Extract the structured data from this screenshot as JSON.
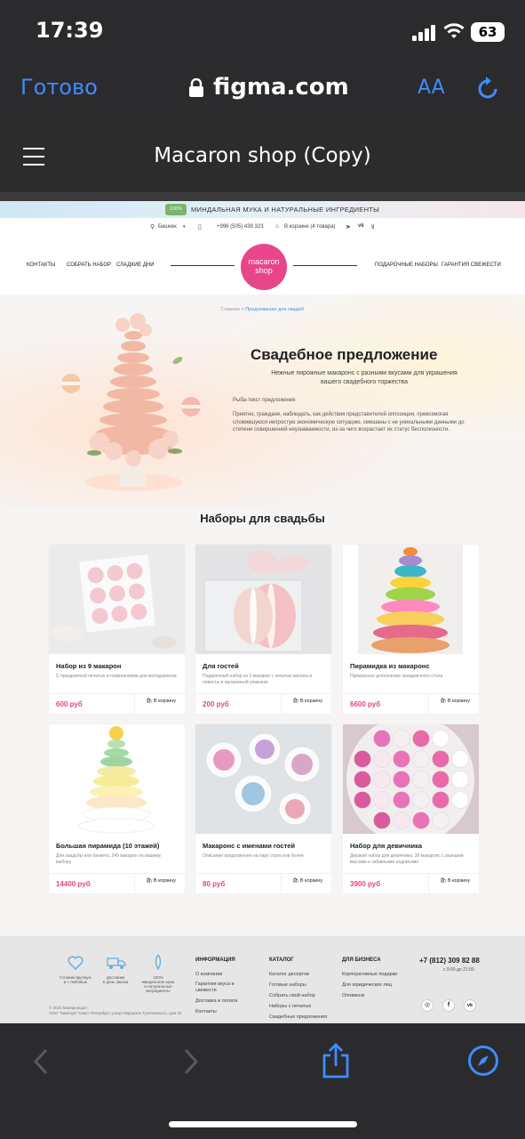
{
  "status": {
    "time": "17:39",
    "battery": "63"
  },
  "safari": {
    "done": "Готово",
    "url": "figma.com",
    "aa": "AA"
  },
  "figma": {
    "title": "Macaron shop (Copy)"
  },
  "site": {
    "promo": "МИНДАЛЬНАЯ МУКА И НАТУРАЛЬНЫЕ ИНГРЕДИЕНТЫ",
    "promo_badge": "100%",
    "city": "Бишкек",
    "phone": "+996 (505) 439 323",
    "cart": "В корзине (4 товара)",
    "nav_left": [
      "КОНТАКТЫ",
      "СОБРАТЬ НАБОР",
      "СЛАДКИЕ ДНИ"
    ],
    "nav_right": [
      "ПОДАРОЧНЫЕ НАБОРЫ",
      "ГАРАНТИЯ СВЕЖЕСТИ"
    ],
    "logo_line1": "macaron",
    "logo_line2": "shop",
    "breadcrumb_home": "Главная",
    "breadcrumb_sep": ">",
    "breadcrumb_current": "Предложение для свадеб",
    "hero_title": "Свадебное предложение",
    "hero_sub": "Нежные пирожные макаронс с разными вкусами для украшения вашего свадебного торжества",
    "fish_label": "Рыба-текст предложения",
    "hero_body": "Приятно, граждане, наблюдать, как действия представителей оппозиции, превозмогая сложившуюся непростую экономическую ситуацию, смешаны с не уникальными данными до степени совершенной неузнаваемости, из-за чего возрастает их статус бесполезности.",
    "sets_title": "Наборы для свадьбы",
    "cart_button": "В корзину",
    "products": [
      {
        "name": "Набор из 9 макарон",
        "desc": "С праздничной печатью и пожеланиями для молодоженов",
        "price": "600 руб"
      },
      {
        "name": "Для гостей",
        "desc": "Подарочный набор из 2 макарон с печатью жениха и невесты в прозрачной упаковке",
        "price": "200 руб"
      },
      {
        "name": "Пирамидка из макаронс",
        "desc": "Прекрасное дополнение праздничного стола",
        "price": "6600 руб"
      },
      {
        "name": "Большая пирамида (10 этажей)",
        "desc": "Для свадьбы или банкета, 240 макарон по вашему выбору",
        "price": "14400 руб"
      },
      {
        "name": "Макаронс с именами гостей",
        "desc": "Описание предложения на пару строк или более",
        "price": "80 руб"
      },
      {
        "name": "Набор для девичника",
        "desc": "Дерзкий набор для девичника. 30 макаронс с разными вкусами и забавными надписями",
        "price": "3900 руб"
      }
    ],
    "footer": {
      "badges": [
        {
          "label": "Готовим вручную\nи с любовью"
        },
        {
          "label": "Доставим\nв день заказа"
        },
        {
          "label": "100%\nминдальная мука\nи натуральные\nингредиенты"
        }
      ],
      "copyright": "© 2021 Макаронщоп\nООО \"Каинзуи\" Санкт-Петербург, улица Маршала Тухачевского, дом 22",
      "col1_title": "ИНФОРМАЦИЯ",
      "col1": [
        "О компании",
        "Гарантии вкуса и свежести",
        "Доставка и оплата",
        "Контакты"
      ],
      "col2_title": "КАТАЛОГ",
      "col2": [
        "Каталог десертов",
        "Готовые наборы",
        "Собрать свой набор",
        "Наборы с печатью",
        "Свадебные предложения"
      ],
      "col3_title": "ДЛЯ БИЗНЕСА",
      "col3": [
        "Корпоративные подарки",
        "Для юридических лиц",
        "Оповиксм"
      ],
      "phone": "+7 (812) 309 82 88",
      "hours": "с 9:00 до 21:00",
      "social": [
        "◎",
        "f",
        "vk"
      ]
    }
  },
  "colors": {
    "accent": "#e8457a",
    "logo": "#e8458b",
    "ios_blue": "#3f8cff"
  }
}
